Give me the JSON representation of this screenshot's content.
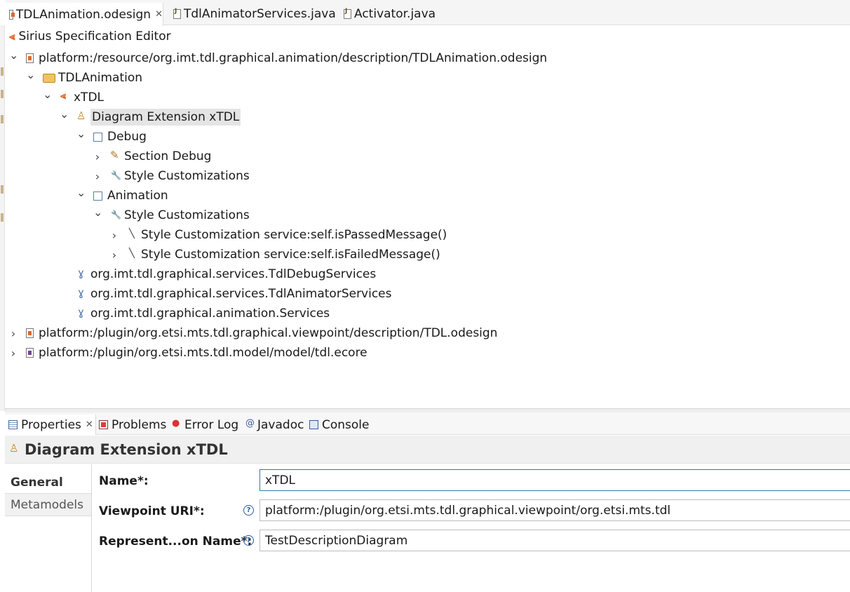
{
  "editor_tabs": [
    {
      "label": "TDLAnimation.odesign",
      "icon": "odesign-file-icon",
      "active": true,
      "closable": true
    },
    {
      "label": "TdlAnimatorServices.java",
      "icon": "java-file-icon",
      "active": false
    },
    {
      "label": "Activator.java",
      "icon": "java-file-icon",
      "active": false
    }
  ],
  "editor_title": "Sirius Specification Editor",
  "tree": [
    {
      "label": "platform:/resource/org.imt.tdl.graphical.animation/description/TDLAnimation.odesign",
      "icon": "resource-file-icon",
      "expanded": true
    },
    {
      "label": "TDLAnimation",
      "icon": "folder-icon",
      "expanded": true
    },
    {
      "label": "xTDL",
      "icon": "viewpoint-icon",
      "expanded": true
    },
    {
      "label": "Diagram Extension xTDL",
      "icon": "diagram-extension-icon",
      "expanded": true,
      "selected": true
    },
    {
      "label": "Debug",
      "icon": "layer-icon",
      "expanded": true
    },
    {
      "label": "Section Debug",
      "icon": "section-icon",
      "expanded": false
    },
    {
      "label": "Style Customizations",
      "icon": "wrench-icon",
      "expanded": false
    },
    {
      "label": "Animation",
      "icon": "layer-icon",
      "expanded": true
    },
    {
      "label": "Style Customizations",
      "icon": "wrench-icon",
      "expanded": true
    },
    {
      "label": "Style Customization service:self.isPassedMessage()",
      "icon": "brush-icon",
      "expanded": false
    },
    {
      "label": "Style Customization service:self.isFailedMessage()",
      "icon": "brush-icon",
      "expanded": false
    },
    {
      "label": "org.imt.tdl.graphical.services.TdlDebugServices",
      "icon": "java-extension-icon"
    },
    {
      "label": "org.imt.tdl.graphical.services.TdlAnimatorServices",
      "icon": "java-extension-icon"
    },
    {
      "label": "org.imt.tdl.graphical.animation.Services",
      "icon": "java-extension-icon"
    },
    {
      "label": "platform:/plugin/org.etsi.mts.tdl.graphical.viewpoint/description/TDL.odesign",
      "icon": "resource-file-icon",
      "expanded": false
    },
    {
      "label": "platform:/plugin/org.etsi.mts.tdl.model/model/tdl.ecore",
      "icon": "ecore-file-icon",
      "expanded": false
    }
  ],
  "view_tabs": [
    {
      "label": "Properties",
      "icon": "properties-icon",
      "active": true,
      "closable": true
    },
    {
      "label": "Problems",
      "icon": "problems-icon"
    },
    {
      "label": "Error Log",
      "icon": "error-log-icon"
    },
    {
      "label": "Javadoc",
      "icon": "javadoc-icon"
    },
    {
      "label": "Console",
      "icon": "console-icon"
    }
  ],
  "properties": {
    "title": "Diagram Extension xTDL",
    "categories": [
      {
        "label": "General",
        "active": true
      },
      {
        "label": "Metamodels",
        "active": false
      }
    ],
    "fields": [
      {
        "label": "Name*:",
        "value": "xTDL",
        "help": false,
        "focused": true
      },
      {
        "label": "Viewpoint URI*:",
        "value": "platform:/plugin/org.etsi.mts.tdl.graphical.viewpoint/org.etsi.mts.tdl",
        "help": true
      },
      {
        "label": "Represent...on Name*:",
        "value": "TestDescriptionDiagram",
        "help": true
      }
    ]
  },
  "colors": {
    "selection": "#e4e4e4",
    "focus_border": "#2a7f9e",
    "sirius_accent": "#e0642a",
    "help_icon": "#2e5aa0"
  }
}
